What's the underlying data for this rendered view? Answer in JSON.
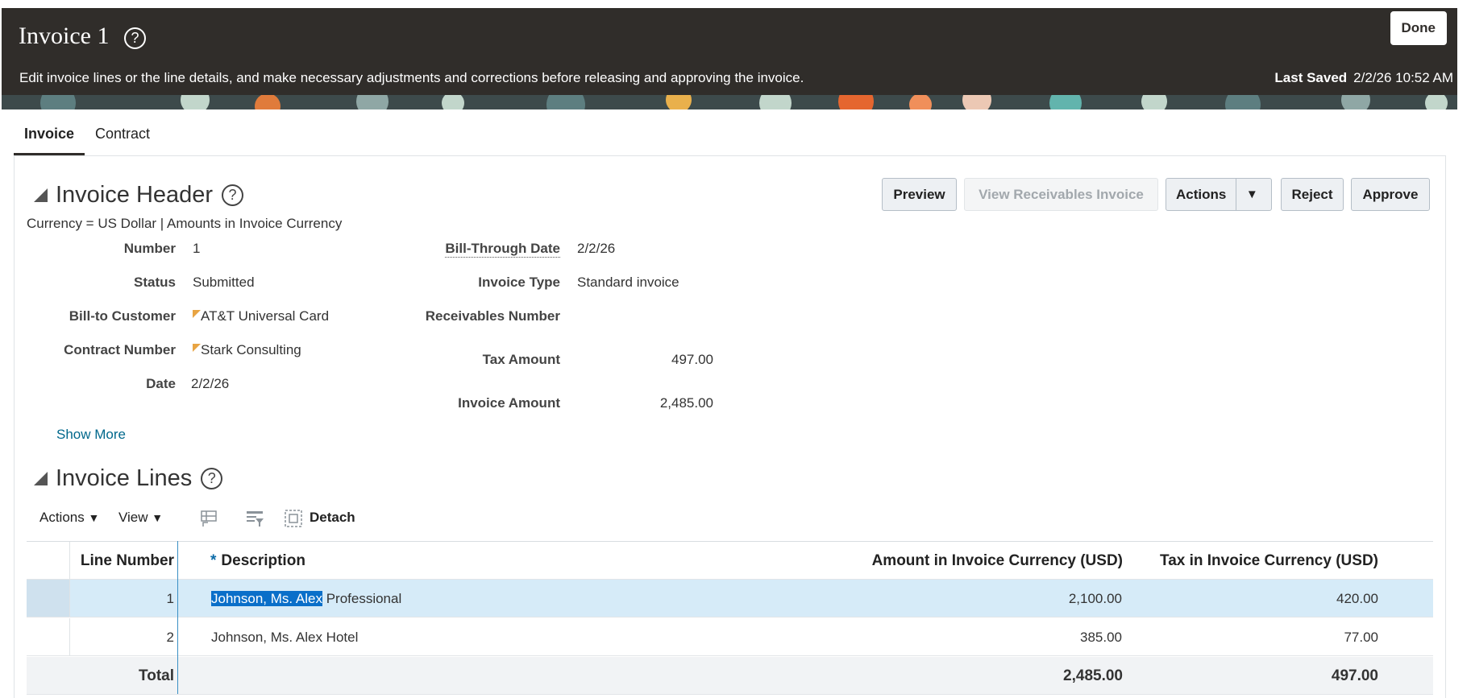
{
  "header": {
    "title": "Invoice 1",
    "subtitle": "Edit invoice lines or the line details, and make necessary adjustments and corrections before releasing and approving the invoice.",
    "last_saved_label": "Last Saved",
    "last_saved_value": "2/2/26 10:52 AM",
    "done_label": "Done",
    "help_glyph": "?"
  },
  "tabs": [
    {
      "label": "Invoice",
      "active": true
    },
    {
      "label": "Contract",
      "active": false
    }
  ],
  "invoice_header": {
    "title": "Invoice Header",
    "currency_note": "Currency = US Dollar | Amounts in Invoice Currency",
    "buttons": {
      "preview": "Preview",
      "view_receivables": "View Receivables Invoice",
      "actions": "Actions",
      "reject": "Reject",
      "approve": "Approve"
    },
    "fields_left": [
      {
        "label": "Number",
        "value": "1"
      },
      {
        "label": "Status",
        "value": "Submitted"
      },
      {
        "label": "Bill-to Customer",
        "value": "AT&T Universal Card"
      },
      {
        "label": "Contract Number",
        "value": "Stark Consulting"
      },
      {
        "label": "Date",
        "value": "2/2/26"
      }
    ],
    "fields_right": [
      {
        "label": "Bill-Through Date",
        "value": "2/2/26"
      },
      {
        "label": "Invoice Type",
        "value": "Standard invoice"
      },
      {
        "label": "Receivables Number",
        "value": ""
      },
      {
        "label": "Tax Amount",
        "value": "497.00"
      },
      {
        "label": "Invoice Amount",
        "value": "2,485.00"
      }
    ],
    "show_more": "Show More"
  },
  "invoice_lines": {
    "title": "Invoice Lines",
    "toolbar": {
      "actions": "Actions",
      "view": "View",
      "detach": "Detach"
    },
    "columns": [
      "Line Number",
      "Description",
      "Amount in Invoice Currency (USD)",
      "Tax in Invoice Currency (USD)"
    ],
    "required_marker": "*",
    "rows": [
      {
        "line": "1",
        "desc_highlight": "Johnson, Ms. Alex",
        "desc_rest": " Professional",
        "amount": "2,100.00",
        "tax": "420.00",
        "selected": true
      },
      {
        "line": "2",
        "desc_highlight": "",
        "desc_rest": "Johnson, Ms. Alex Hotel",
        "amount": "385.00",
        "tax": "77.00",
        "selected": false
      }
    ],
    "total": {
      "label": "Total",
      "amount": "2,485.00",
      "tax": "497.00"
    }
  },
  "colors": {
    "banner": "#302d2a",
    "selection": "#d6ebf8",
    "link": "#00688c",
    "flag": "#e8a443"
  }
}
